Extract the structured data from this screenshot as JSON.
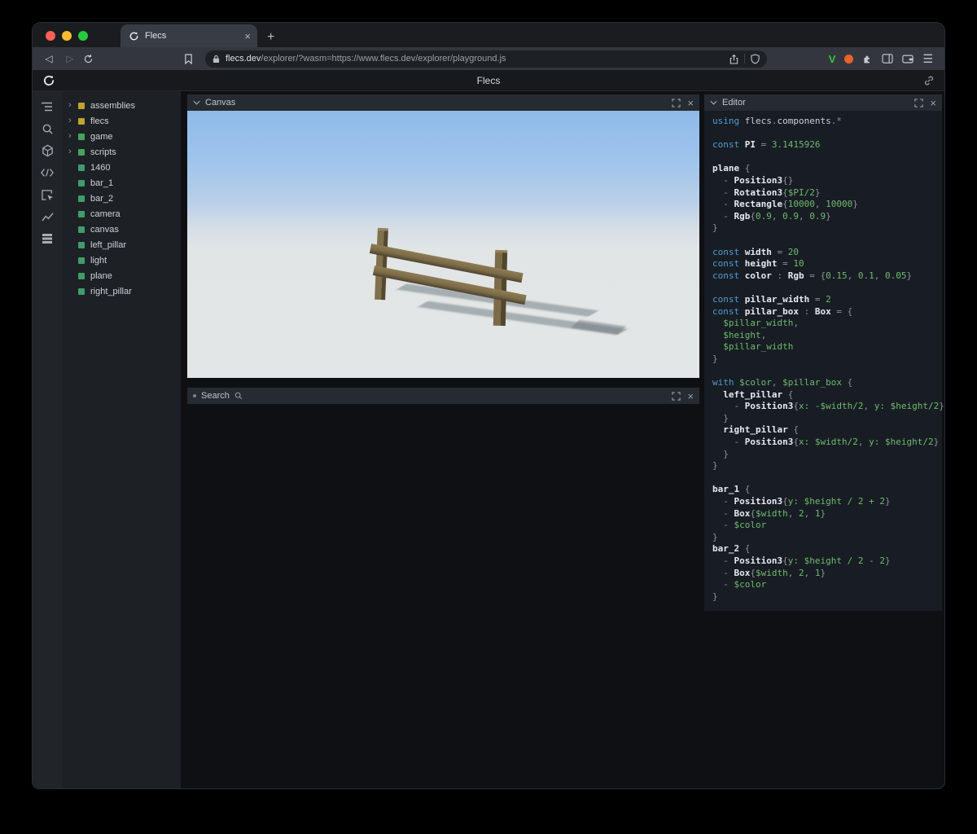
{
  "browser": {
    "tab": {
      "title": "Flecs"
    },
    "url": {
      "domain": "flecs.dev",
      "path": "/explorer/?wasm=https://www.flecs.dev/explorer/playground.js"
    }
  },
  "app": {
    "title": "Flecs"
  },
  "panels": {
    "canvas": {
      "title": "Canvas"
    },
    "search": {
      "title": "Search"
    },
    "editor": {
      "title": "Editor"
    }
  },
  "icons": {
    "close": "×",
    "new_tab": "+",
    "menu": "☰",
    "tree_expand": "›",
    "back": "◁",
    "forward": "▷",
    "extension_v": "V"
  },
  "colors": {
    "module_square": "#c0a332",
    "entity_square": "#3f9d6b",
    "keyword": "#509bd8",
    "value_green": "#6fba72",
    "punctuation": "#8a929a"
  },
  "tree": {
    "items": [
      {
        "label": "assemblies",
        "color": "#c0a332",
        "expandable": true
      },
      {
        "label": "flecs",
        "color": "#c0a332",
        "expandable": true
      },
      {
        "label": "game",
        "color": "#48a35c",
        "expandable": true
      },
      {
        "label": "scripts",
        "color": "#48a35c",
        "expandable": true
      },
      {
        "label": "1460",
        "color": "#3f9d6b",
        "expandable": false
      },
      {
        "label": "bar_1",
        "color": "#3f9d6b",
        "expandable": false
      },
      {
        "label": "bar_2",
        "color": "#3f9d6b",
        "expandable": false
      },
      {
        "label": "camera",
        "color": "#3f9d6b",
        "expandable": false
      },
      {
        "label": "canvas",
        "color": "#3f9d6b",
        "expandable": false
      },
      {
        "label": "left_pillar",
        "color": "#3f9d6b",
        "expandable": false
      },
      {
        "label": "light",
        "color": "#3f9d6b",
        "expandable": false
      },
      {
        "label": "plane",
        "color": "#3f9d6b",
        "expandable": false
      },
      {
        "label": "right_pillar",
        "color": "#3f9d6b",
        "expandable": false
      }
    ]
  },
  "editor_code": {
    "lines": [
      [
        {
          "t": "using ",
          "c": "kw"
        },
        {
          "t": "flecs",
          "c": "d"
        },
        {
          "t": ".",
          "c": "p"
        },
        {
          "t": "components",
          "c": "d"
        },
        {
          "t": ".*",
          "c": "p"
        }
      ],
      [],
      [
        {
          "t": "const ",
          "c": "kw"
        },
        {
          "t": "PI",
          "c": "b"
        },
        {
          "t": " = ",
          "c": "p"
        },
        {
          "t": "3.1415926",
          "c": "g"
        }
      ],
      [],
      [
        {
          "t": "plane",
          "c": "b"
        },
        {
          "t": " {",
          "c": "p"
        }
      ],
      [
        {
          "t": "  - ",
          "c": "p"
        },
        {
          "t": "Position3",
          "c": "b"
        },
        {
          "t": "{}",
          "c": "p"
        }
      ],
      [
        {
          "t": "  - ",
          "c": "p"
        },
        {
          "t": "Rotation3",
          "c": "b"
        },
        {
          "t": "{",
          "c": "p"
        },
        {
          "t": "$PI/2",
          "c": "g"
        },
        {
          "t": "}",
          "c": "p"
        }
      ],
      [
        {
          "t": "  - ",
          "c": "p"
        },
        {
          "t": "Rectangle",
          "c": "b"
        },
        {
          "t": "{",
          "c": "p"
        },
        {
          "t": "10000",
          "c": "g"
        },
        {
          "t": ", ",
          "c": "p"
        },
        {
          "t": "10000",
          "c": "g"
        },
        {
          "t": "}",
          "c": "p"
        }
      ],
      [
        {
          "t": "  - ",
          "c": "p"
        },
        {
          "t": "Rgb",
          "c": "b"
        },
        {
          "t": "{",
          "c": "p"
        },
        {
          "t": "0.9",
          "c": "g"
        },
        {
          "t": ", ",
          "c": "p"
        },
        {
          "t": "0.9",
          "c": "g"
        },
        {
          "t": ", ",
          "c": "p"
        },
        {
          "t": "0.9",
          "c": "g"
        },
        {
          "t": "}",
          "c": "p"
        }
      ],
      [
        {
          "t": "}",
          "c": "p"
        }
      ],
      [],
      [
        {
          "t": "const ",
          "c": "kw"
        },
        {
          "t": "width",
          "c": "b"
        },
        {
          "t": " = ",
          "c": "p"
        },
        {
          "t": "20",
          "c": "g"
        }
      ],
      [
        {
          "t": "const ",
          "c": "kw"
        },
        {
          "t": "height",
          "c": "b"
        },
        {
          "t": " = ",
          "c": "p"
        },
        {
          "t": "10",
          "c": "g"
        }
      ],
      [
        {
          "t": "const ",
          "c": "kw"
        },
        {
          "t": "color",
          "c": "b"
        },
        {
          "t": " : ",
          "c": "p"
        },
        {
          "t": "Rgb",
          "c": "b"
        },
        {
          "t": " = {",
          "c": "p"
        },
        {
          "t": "0.15",
          "c": "g"
        },
        {
          "t": ", ",
          "c": "p"
        },
        {
          "t": "0.1",
          "c": "g"
        },
        {
          "t": ", ",
          "c": "p"
        },
        {
          "t": "0.05",
          "c": "g"
        },
        {
          "t": "}",
          "c": "p"
        }
      ],
      [],
      [
        {
          "t": "const ",
          "c": "kw"
        },
        {
          "t": "pillar_width",
          "c": "b"
        },
        {
          "t": " = ",
          "c": "p"
        },
        {
          "t": "2",
          "c": "g"
        }
      ],
      [
        {
          "t": "const ",
          "c": "kw"
        },
        {
          "t": "pillar_box",
          "c": "b"
        },
        {
          "t": " : ",
          "c": "p"
        },
        {
          "t": "Box",
          "c": "b"
        },
        {
          "t": " = {",
          "c": "p"
        }
      ],
      [
        {
          "t": "  ",
          "c": "p"
        },
        {
          "t": "$pillar_width",
          "c": "g"
        },
        {
          "t": ",",
          "c": "p"
        }
      ],
      [
        {
          "t": "  ",
          "c": "p"
        },
        {
          "t": "$height",
          "c": "g"
        },
        {
          "t": ",",
          "c": "p"
        }
      ],
      [
        {
          "t": "  ",
          "c": "p"
        },
        {
          "t": "$pillar_width",
          "c": "g"
        }
      ],
      [
        {
          "t": "}",
          "c": "p"
        }
      ],
      [],
      [
        {
          "t": "with ",
          "c": "kw"
        },
        {
          "t": "$color",
          "c": "g"
        },
        {
          "t": ", ",
          "c": "p"
        },
        {
          "t": "$pillar_box",
          "c": "g"
        },
        {
          "t": " {",
          "c": "p"
        }
      ],
      [
        {
          "t": "  ",
          "c": "p"
        },
        {
          "t": "left_pillar",
          "c": "b"
        },
        {
          "t": " {",
          "c": "p"
        }
      ],
      [
        {
          "t": "    - ",
          "c": "p"
        },
        {
          "t": "Position3",
          "c": "b"
        },
        {
          "t": "{",
          "c": "p"
        },
        {
          "t": "x: -$width/2",
          "c": "g"
        },
        {
          "t": ", ",
          "c": "p"
        },
        {
          "t": "y: $height/2",
          "c": "g"
        },
        {
          "t": "}",
          "c": "p"
        }
      ],
      [
        {
          "t": "  }",
          "c": "p"
        }
      ],
      [
        {
          "t": "  ",
          "c": "p"
        },
        {
          "t": "right_pillar",
          "c": "b"
        },
        {
          "t": " {",
          "c": "p"
        }
      ],
      [
        {
          "t": "    - ",
          "c": "p"
        },
        {
          "t": "Position3",
          "c": "b"
        },
        {
          "t": "{",
          "c": "p"
        },
        {
          "t": "x: $width/2",
          "c": "g"
        },
        {
          "t": ", ",
          "c": "p"
        },
        {
          "t": "y: $height/2",
          "c": "g"
        },
        {
          "t": "}",
          "c": "p"
        }
      ],
      [
        {
          "t": "  }",
          "c": "p"
        }
      ],
      [
        {
          "t": "}",
          "c": "p"
        }
      ],
      [],
      [
        {
          "t": "bar_1",
          "c": "b"
        },
        {
          "t": " {",
          "c": "p"
        }
      ],
      [
        {
          "t": "  - ",
          "c": "p"
        },
        {
          "t": "Position3",
          "c": "b"
        },
        {
          "t": "{",
          "c": "p"
        },
        {
          "t": "y: $height / 2 + 2",
          "c": "g"
        },
        {
          "t": "}",
          "c": "p"
        }
      ],
      [
        {
          "t": "  - ",
          "c": "p"
        },
        {
          "t": "Box",
          "c": "b"
        },
        {
          "t": "{",
          "c": "p"
        },
        {
          "t": "$width",
          "c": "g"
        },
        {
          "t": ", ",
          "c": "p"
        },
        {
          "t": "2",
          "c": "g"
        },
        {
          "t": ", ",
          "c": "p"
        },
        {
          "t": "1",
          "c": "g"
        },
        {
          "t": "}",
          "c": "p"
        }
      ],
      [
        {
          "t": "  - ",
          "c": "p"
        },
        {
          "t": "$color",
          "c": "g"
        }
      ],
      [
        {
          "t": "}",
          "c": "p"
        }
      ],
      [
        {
          "t": "bar_2",
          "c": "b"
        },
        {
          "t": " {",
          "c": "p"
        }
      ],
      [
        {
          "t": "  - ",
          "c": "p"
        },
        {
          "t": "Position3",
          "c": "b"
        },
        {
          "t": "{",
          "c": "p"
        },
        {
          "t": "y: $height / 2 - 2",
          "c": "g"
        },
        {
          "t": "}",
          "c": "p"
        }
      ],
      [
        {
          "t": "  - ",
          "c": "p"
        },
        {
          "t": "Box",
          "c": "b"
        },
        {
          "t": "{",
          "c": "p"
        },
        {
          "t": "$width",
          "c": "g"
        },
        {
          "t": ", ",
          "c": "p"
        },
        {
          "t": "2",
          "c": "g"
        },
        {
          "t": ", ",
          "c": "p"
        },
        {
          "t": "1",
          "c": "g"
        },
        {
          "t": "}",
          "c": "p"
        }
      ],
      [
        {
          "t": "  - ",
          "c": "p"
        },
        {
          "t": "$color",
          "c": "g"
        }
      ],
      [
        {
          "t": "}",
          "c": "p"
        }
      ]
    ]
  }
}
